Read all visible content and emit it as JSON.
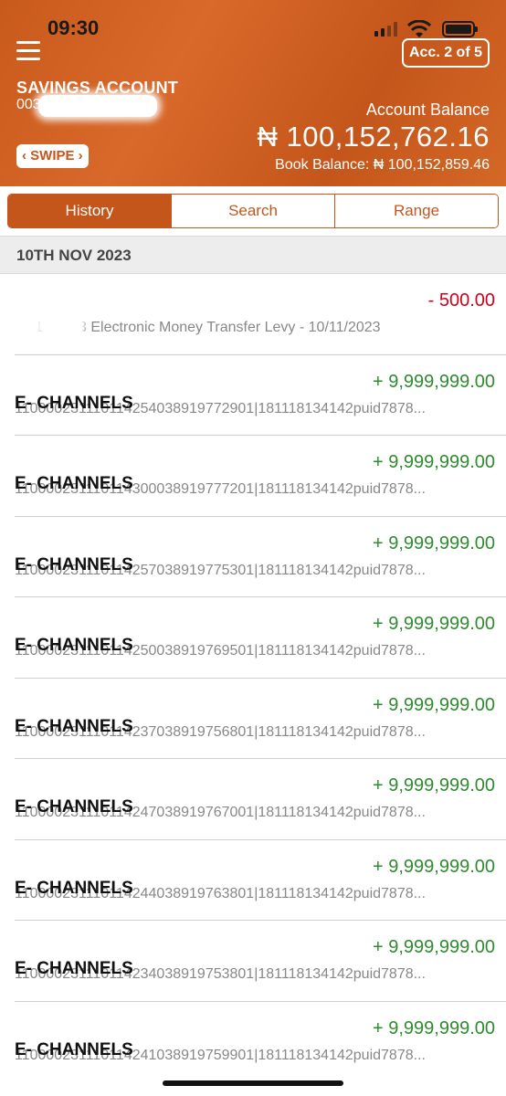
{
  "status_bar": {
    "time": "09:30"
  },
  "header": {
    "account_badge": "Acc. 2 of 5",
    "account_type": "SAVINGS ACCOUNT",
    "account_number_visible": "003",
    "swipe_label": "‹ SWIPE ›",
    "balance_label": "Account Balance",
    "balance_value": "₦ 100,152,762.16",
    "book_balance": "Book Balance: ₦ 100,152,859.46"
  },
  "tabs": [
    {
      "label": "History",
      "active": true
    },
    {
      "label": "Search",
      "active": false
    },
    {
      "label": "Range",
      "active": false
    }
  ],
  "date_header": "10TH NOV 2023",
  "transactions": [
    {
      "amount": "- 500.00",
      "type": "debit",
      "title": "",
      "description": "10/11/2023 Electronic Money Transfer Levy - 10/11/2023"
    },
    {
      "amount": "+ 9,999,999.00",
      "type": "credit",
      "title": "E- CHANNELS",
      "description": "110000231110114254038919772901|181118134142puid7878..."
    },
    {
      "amount": "+ 9,999,999.00",
      "type": "credit",
      "title": "E- CHANNELS",
      "description": "110000231110114300038919777201|181118134142puid7878..."
    },
    {
      "amount": "+ 9,999,999.00",
      "type": "credit",
      "title": "E- CHANNELS",
      "description": "110000231110114257038919775301|181118134142puid7878..."
    },
    {
      "amount": "+ 9,999,999.00",
      "type": "credit",
      "title": "E- CHANNELS",
      "description": "110000231110114250038919769501|181118134142puid7878..."
    },
    {
      "amount": "+ 9,999,999.00",
      "type": "credit",
      "title": "E- CHANNELS",
      "description": "110000231110114237038919756801|181118134142puid7878..."
    },
    {
      "amount": "+ 9,999,999.00",
      "type": "credit",
      "title": "E- CHANNELS",
      "description": "110000231110114247038919767001|181118134142puid7878..."
    },
    {
      "amount": "+ 9,999,999.00",
      "type": "credit",
      "title": "E- CHANNELS",
      "description": "110000231110114244038919763801|181118134142puid7878..."
    },
    {
      "amount": "+ 9,999,999.00",
      "type": "credit",
      "title": "E- CHANNELS",
      "description": "110000231110114234038919753801|181118134142puid7878..."
    },
    {
      "amount": "+ 9,999,999.00",
      "type": "credit",
      "title": "E- CHANNELS",
      "description": "110000231110114241038919759901|181118134142puid7878..."
    }
  ],
  "colors": {
    "header_orange": "#c85a1c",
    "accent": "#c4561b",
    "debit": "#d0021b",
    "credit": "#2e8b2e"
  }
}
